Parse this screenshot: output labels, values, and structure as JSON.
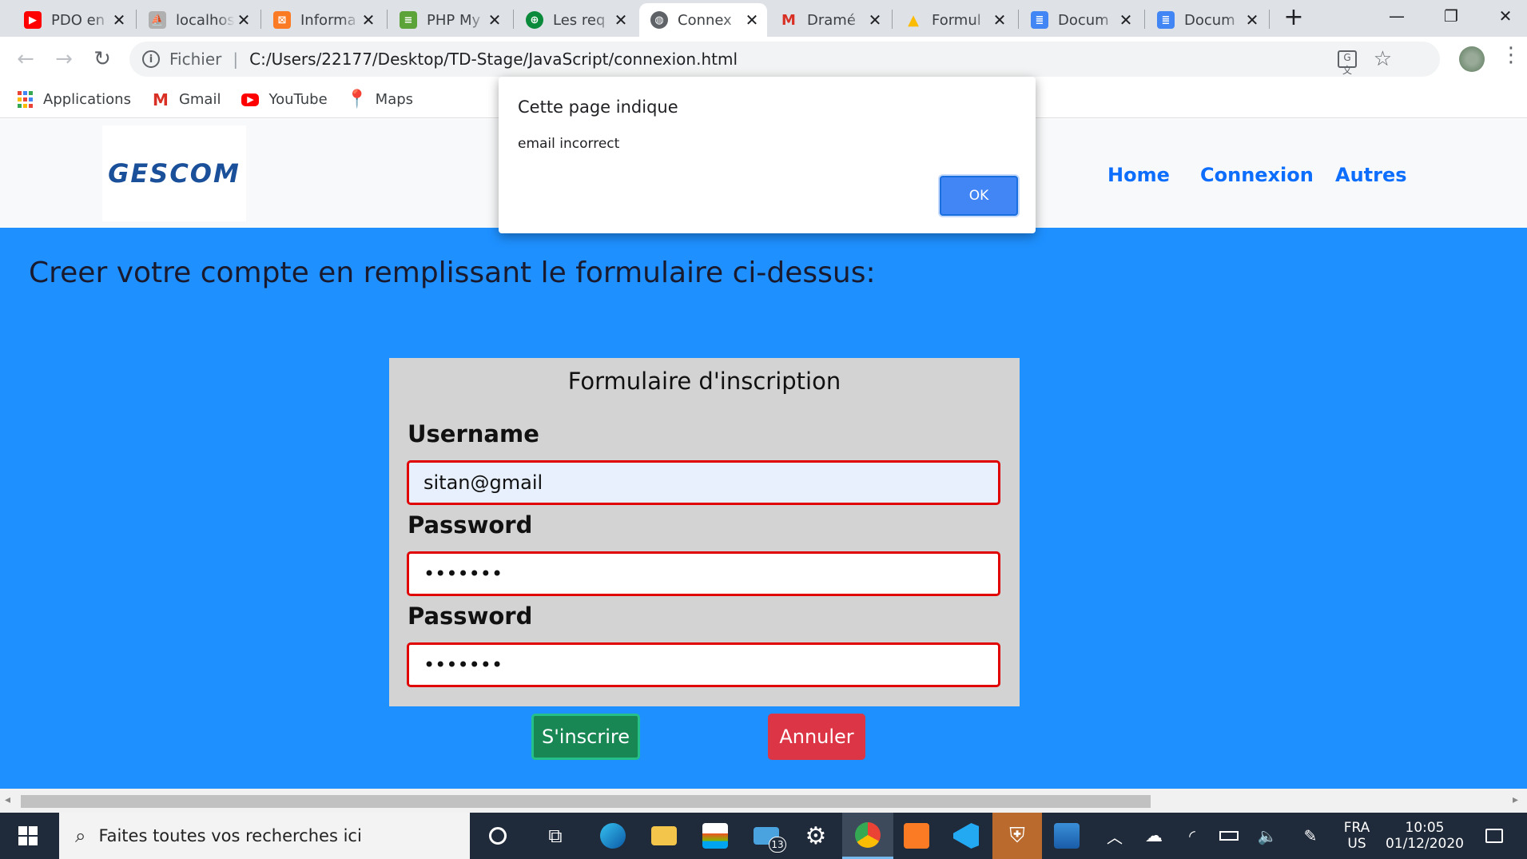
{
  "browser": {
    "tabs": [
      {
        "title": "PDO en",
        "favicon": "youtube-icon",
        "color": "#ff0000",
        "glyph": "▶"
      },
      {
        "title": "localhost",
        "favicon": "phpmyadmin-icon",
        "color": "#8a8a8a",
        "glyph": "⛵"
      },
      {
        "title": "Informa",
        "favicon": "xampp-icon",
        "color": "#fb7a24",
        "glyph": "⊠"
      },
      {
        "title": "PHP My",
        "favicon": "php-icon",
        "color": "#5ca33a",
        "glyph": "≡"
      },
      {
        "title": "Les req",
        "favicon": "globe-green-icon",
        "color": "#0a8a3a",
        "glyph": "⊕"
      },
      {
        "title": "Connex",
        "favicon": "globe-icon",
        "color": "#5f6368",
        "glyph": "◍"
      },
      {
        "title": "Dramé",
        "favicon": "gmail-icon",
        "color": "#ffffff",
        "glyph": "M"
      },
      {
        "title": "Formul",
        "favicon": "drive-icon",
        "color": "#ffffff",
        "glyph": "▲"
      },
      {
        "title": "Docum",
        "favicon": "docs-icon",
        "color": "#4285f4",
        "glyph": "≣"
      },
      {
        "title": "Docum",
        "favicon": "docs-icon",
        "color": "#4285f4",
        "glyph": "≣"
      }
    ],
    "new_tab": "+",
    "url_prefix": "Fichier",
    "url": "C:/Users/22177/Desktop/TD-Stage/JavaScript/connexion.html",
    "bookmarks": [
      {
        "label": "Applications",
        "icon": "apps-grid-icon"
      },
      {
        "label": "Gmail",
        "icon": "gmail-icon"
      },
      {
        "label": "YouTube",
        "icon": "youtube-icon"
      },
      {
        "label": "Maps",
        "icon": "maps-pin-icon"
      }
    ]
  },
  "dialog": {
    "title": "Cette page indique",
    "message": "email incorrect",
    "ok_label": "OK"
  },
  "page": {
    "logo_text": "GESCOM",
    "nav": [
      "Home",
      "Connexion",
      "Autres"
    ],
    "heading": "Creer votre compte en remplissant le formulaire ci-dessus:",
    "form": {
      "title": "Formulaire d'inscription",
      "username_label": "Username",
      "username_value": "sitan@gmail",
      "password_label": "Password",
      "password_value": "•••••••",
      "password2_label": "Password",
      "password2_value": "•••••••",
      "submit_label": "S'inscrire",
      "cancel_label": "Annuler"
    },
    "colors": {
      "background": "#1e90ff",
      "form": "#d3d3d3",
      "input_border": "#e00000",
      "submit": "#198754",
      "cancel": "#dc3545",
      "link": "#0d6efd"
    }
  },
  "taskbar": {
    "search_placeholder": "Faites toutes vos recherches ici",
    "mail_badge": "13",
    "lang_top": "FRA",
    "lang_bottom": "US",
    "time": "10:05",
    "date": "01/12/2020"
  }
}
